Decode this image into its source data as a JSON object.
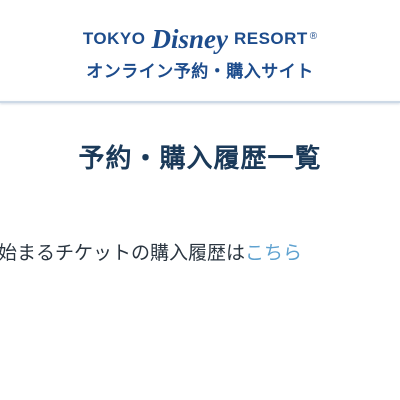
{
  "header": {
    "logo_left": "TOKYO",
    "logo_script": "Disney",
    "logo_right": "RESORT",
    "logo_reg": "®",
    "subtitle": "オンライン予約・購入サイト"
  },
  "main": {
    "title": "予約・購入履歴一覧",
    "notice_text": "始まるチケットの購入履歴は",
    "notice_link": "こちら"
  },
  "colors": {
    "brand_blue": "#1d4c8c",
    "title_navy": "#1b3a59",
    "link_blue": "#5fa2d0"
  }
}
